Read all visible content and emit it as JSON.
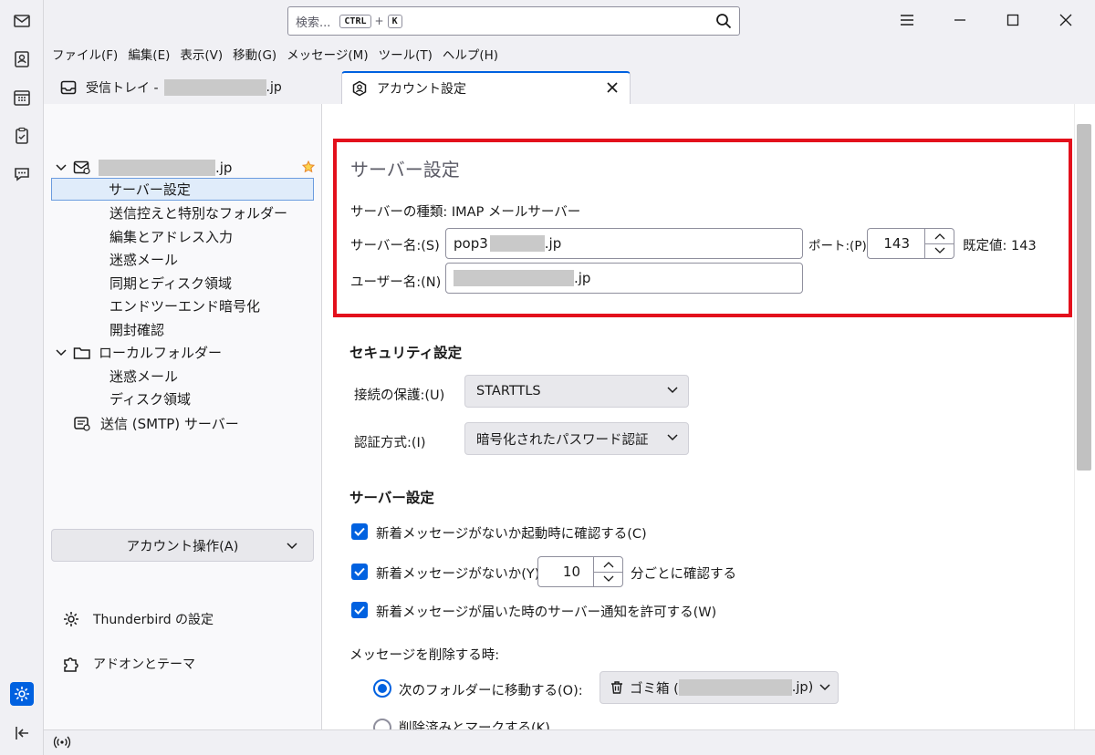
{
  "search": {
    "placeholder": "検索...",
    "key1": "CTRL",
    "plus": "+",
    "key2": "K"
  },
  "menubar": [
    "ファイル(F)",
    "編集(E)",
    "表示(V)",
    "移動(G)",
    "メッセージ(M)",
    "ツール(T)",
    "ヘルプ(H)"
  ],
  "tabs": {
    "inbox_prefix": "受信トレイ -",
    "inbox_suffix": ".jp",
    "account_settings": "アカウント設定"
  },
  "sidebar": {
    "account_suffix": ".jp",
    "items": [
      "サーバー設定",
      "送信控えと特別なフォルダー",
      "編集とアドレス入力",
      "迷惑メール",
      "同期とディスク領域",
      "エンドツーエンド暗号化",
      "開封確認"
    ],
    "local_folders": "ローカルフォルダー",
    "local_items": [
      "迷惑メール",
      "ディスク領域"
    ],
    "smtp": "送信 (SMTP) サーバー",
    "account_ops": "アカウント操作(A)",
    "thunderbird_settings": "Thunderbird の設定",
    "addons": "アドオンとテーマ"
  },
  "server": {
    "title": "サーバー設定",
    "type_label": "サーバーの種類:",
    "type_value": "IMAP メールサーバー",
    "name_label": "サーバー名:(S)",
    "name_prefix": "pop3",
    "name_suffix": ".jp",
    "port_label": "ポート:(P)",
    "port_value": "143",
    "default_label": "既定値: 143",
    "user_label": "ユーザー名:(N)",
    "user_suffix": ".jp"
  },
  "security": {
    "title": "セキュリティ設定",
    "conn_label": "接続の保護:(U)",
    "conn_value": "STARTTLS",
    "auth_label": "認証方式:(I)",
    "auth_value": "暗号化されたパスワード認証"
  },
  "server2": {
    "title": "サーバー設定",
    "check_startup": "新着メッセージがないか起動時に確認する(C)",
    "check_every_prefix": "新着メッセージがないか(Y)",
    "check_every_value": "10",
    "check_every_suffix": "分ごとに確認する",
    "allow_notify": "新着メッセージが届いた時のサーバー通知を許可する(W)",
    "delete_label": "メッセージを削除する時:",
    "move_to_folder": "次のフォルダーに移動する(O):",
    "trash_prefix": "ゴミ箱 (",
    "trash_suffix": ".jp)",
    "mark_deleted": "削除済みとマークする(K)"
  },
  "colors": {
    "accent": "#0061e0",
    "highlight_box": "#e3101c",
    "star": "#e8872c"
  }
}
